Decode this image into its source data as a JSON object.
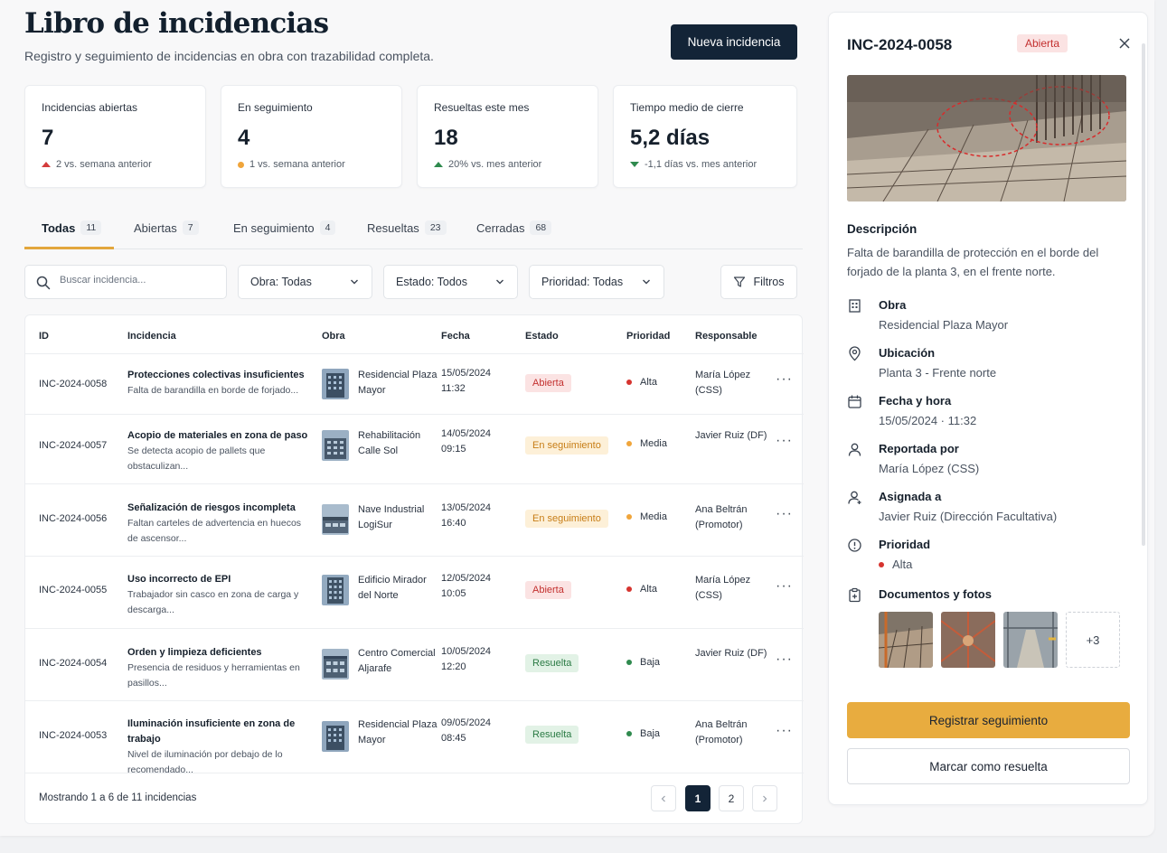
{
  "header": {
    "title": "Libro de incidencias",
    "subtitle": "Registro y seguimiento de incidencias en obra con trazabilidad completa.",
    "new_button": "Nueva incidencia"
  },
  "kpis": [
    {
      "label": "Incidencias abiertas",
      "value": "7",
      "trend": "2 vs. semana anterior",
      "trend_icon": "triangle-up-red-icon"
    },
    {
      "label": "En seguimiento",
      "value": "4",
      "trend": "1 vs. semana anterior",
      "trend_icon": "orange-dot-icon"
    },
    {
      "label": "Resueltas este mes",
      "value": "18",
      "trend": "20% vs. mes anterior",
      "trend_icon": "triangle-up-green-icon"
    },
    {
      "label": "Tiempo medio de cierre",
      "value": "5,2 días",
      "trend": "-1,1 días vs. mes anterior",
      "trend_icon": "triangle-down-green-icon"
    }
  ],
  "tabs": [
    {
      "label": "Todas",
      "count": "11"
    },
    {
      "label": "Abiertas",
      "count": "7"
    },
    {
      "label": "En seguimiento",
      "count": "4"
    },
    {
      "label": "Resueltas",
      "count": "23"
    },
    {
      "label": "Cerradas",
      "count": "68"
    }
  ],
  "filters": {
    "search_placeholder": "Buscar incidencia...",
    "obra": "Obra:  Todas",
    "estado": "Estado: Todos",
    "prioridad": "Prioridad: Todas",
    "filters_button": "Filtros"
  },
  "table": {
    "headers": [
      "ID",
      "Incidencia",
      "Obra",
      "Fecha",
      "Estado",
      "Prioridad",
      "Responsable"
    ],
    "rows": [
      {
        "id": "INC-2024-0058",
        "title": "Protecciones colectivas insuficientes",
        "desc": "Falta de barandilla en borde de forjado...",
        "obra": "Residencial Plaza Mayor",
        "fecha": "15/05/2024",
        "hora": "11:32",
        "estado": "Abierta",
        "prioridad": "Alta",
        "responsable": "María López (CSS)"
      },
      {
        "id": "INC-2024-0057",
        "title": "Acopio de materiales en zona de paso",
        "desc": "Se detecta acopio de pallets que obstaculizan...",
        "obra": "Rehabilitación Calle Sol",
        "fecha": "14/05/2024",
        "hora": "09:15",
        "estado": "En seguimiento",
        "prioridad": "Media",
        "responsable": "Javier Ruiz (DF)"
      },
      {
        "id": "INC-2024-0056",
        "title": "Señalización de riesgos incompleta",
        "desc": "Faltan carteles de advertencia en huecos de ascensor...",
        "obra": "Nave Industrial LogiSur",
        "fecha": "13/05/2024",
        "hora": "16:40",
        "estado": "En seguimiento",
        "prioridad": "Media",
        "responsable": "Ana Beltrán (Promotor)"
      },
      {
        "id": "INC-2024-0055",
        "title": "Uso incorrecto de EPI",
        "desc": "Trabajador sin casco en zona de carga y descarga...",
        "obra": "Edificio Mirador del Norte",
        "fecha": "12/05/2024",
        "hora": "10:05",
        "estado": "Abierta",
        "prioridad": "Alta",
        "responsable": "María López (CSS)"
      },
      {
        "id": "INC-2024-0054",
        "title": "Orden y limpieza deficientes",
        "desc": "Presencia de residuos y herramientas en pasillos...",
        "obra": "Centro Comercial Aljarafe",
        "fecha": "10/05/2024",
        "hora": "12:20",
        "estado": "Resuelta",
        "prioridad": "Baja",
        "responsable": "Javier Ruiz (DF)"
      },
      {
        "id": "INC-2024-0053",
        "title": "Iluminación insuficiente en zona de trabajo",
        "desc": "Nivel de iluminación por debajo de lo recomendado...",
        "obra": "Residencial Plaza Mayor",
        "fecha": "09/05/2024",
        "hora": "08:45",
        "estado": "Resuelta",
        "prioridad": "Baja",
        "responsable": "Ana Beltrán (Promotor)"
      }
    ],
    "footer": "Mostrando 1 a 6 de 11 incidencias",
    "pages": [
      "1",
      "2"
    ]
  },
  "detail": {
    "id": "INC-2024-0058",
    "status": "Abierta",
    "description_label": "Descripción",
    "description": "Falta de barandilla de protección en el borde del forjado de la planta 3, en el frente norte.",
    "fields": [
      {
        "label": "Obra",
        "value": "Residencial Plaza Mayor",
        "icon": "building-icon"
      },
      {
        "label": "Ubicación",
        "value": "Planta 3 - Frente norte",
        "icon": "location-pin-icon"
      },
      {
        "label": "Fecha y hora",
        "value": "15/05/2024  ·  11:32",
        "icon": "calendar-icon"
      },
      {
        "label": "Reportada por",
        "value": "María López (CSS)",
        "icon": "user-icon"
      },
      {
        "label": "Asignada a",
        "value": "Javier Ruiz (Dirección Facultativa)",
        "icon": "user-assigned-icon"
      },
      {
        "label": "Prioridad",
        "value": "Alta",
        "icon": "alert-circle-icon"
      }
    ],
    "docs_label": "Documentos y fotos",
    "docs_more": "+3",
    "primary_button": "Registrar seguimiento",
    "secondary_button": "Marcar como resuelta"
  },
  "colors": {
    "accent": "#e8ac3f",
    "navy": "#132437",
    "alta": "#d6342f",
    "media": "#f0a53b",
    "baja": "#2f8a4e"
  }
}
